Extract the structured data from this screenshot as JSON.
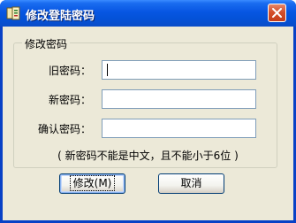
{
  "window": {
    "title": "修改登陆密码",
    "icon": "app-icon",
    "close_icon": "close-icon"
  },
  "form": {
    "group_title": "修改密码",
    "fields": [
      {
        "label": "旧密码：",
        "value": "",
        "type": "password"
      },
      {
        "label": "新密码：",
        "value": "",
        "type": "password"
      },
      {
        "label": "确认密码：",
        "value": "",
        "type": "password"
      }
    ],
    "hint": "( 新密码不能是中文，且不能小于6位 )"
  },
  "buttons": {
    "ok_label": "修改(M)",
    "cancel_label": "取消"
  },
  "colors": {
    "titlebar": "#0756e2",
    "face": "#ece9d8",
    "close": "#d4502c"
  }
}
